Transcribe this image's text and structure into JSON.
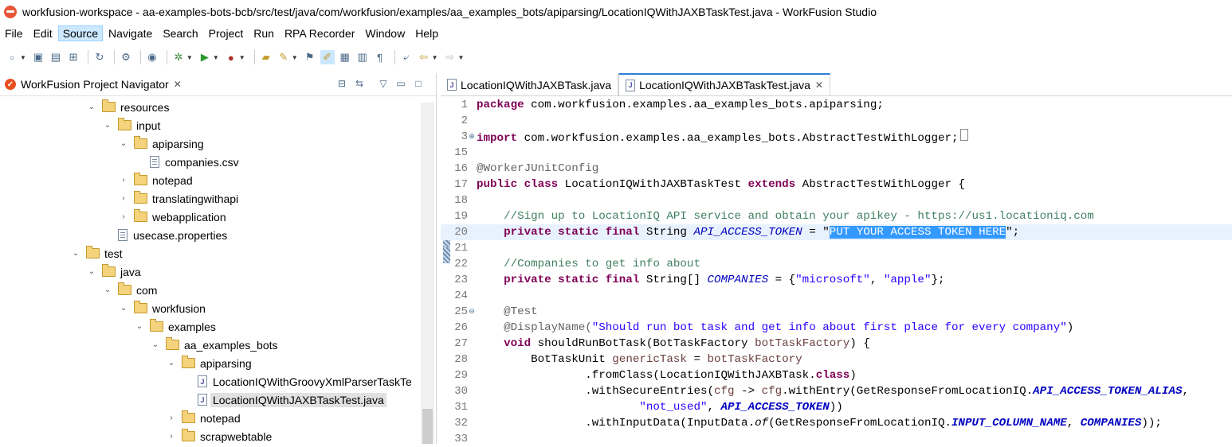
{
  "window": {
    "title": "workfusion-workspace - aa-examples-bots-bcb/src/test/java/com/workfusion/examples/aa_examples_bots/apiparsing/LocationIQWithJAXBTaskTest.java - WorkFusion Studio"
  },
  "menu": [
    "File",
    "Edit",
    "Source",
    "Navigate",
    "Search",
    "Project",
    "Run",
    "RPA Recorder",
    "Window",
    "Help"
  ],
  "menu_active": "Source",
  "navigator": {
    "title": "WorkFusion Project Navigator",
    "items": [
      {
        "label": "resources",
        "type": "folder",
        "expanded": true
      },
      {
        "label": "input",
        "type": "folder",
        "expanded": true
      },
      {
        "label": "apiparsing",
        "type": "folder",
        "expanded": true
      },
      {
        "label": "companies.csv",
        "type": "file"
      },
      {
        "label": "notepad",
        "type": "folder",
        "expanded": false
      },
      {
        "label": "translatingwithapi",
        "type": "folder",
        "expanded": false
      },
      {
        "label": "webapplication",
        "type": "folder",
        "expanded": false
      },
      {
        "label": "usecase.properties",
        "type": "file"
      },
      {
        "label": "test",
        "type": "folder",
        "expanded": true
      },
      {
        "label": "java",
        "type": "folder",
        "expanded": true
      },
      {
        "label": "com",
        "type": "folder",
        "expanded": true
      },
      {
        "label": "workfusion",
        "type": "folder",
        "expanded": true
      },
      {
        "label": "examples",
        "type": "folder",
        "expanded": true
      },
      {
        "label": "aa_examples_bots",
        "type": "folder",
        "expanded": true
      },
      {
        "label": "apiparsing",
        "type": "folder",
        "expanded": true
      },
      {
        "label": "LocationIQWithGroovyXmlParserTaskTe",
        "type": "java"
      },
      {
        "label": "LocationIQWithJAXBTaskTest.java",
        "type": "java",
        "selected": true
      },
      {
        "label": "notepad",
        "type": "folder",
        "expanded": false
      },
      {
        "label": "scrapwebtable",
        "type": "folder",
        "expanded": false
      }
    ]
  },
  "editor": {
    "tabs": [
      {
        "label": "LocationIQWithJAXBTask.java",
        "active": false
      },
      {
        "label": "LocationIQWithJAXBTaskTest.java",
        "active": true
      }
    ],
    "line_numbers": [
      "1",
      "2",
      "3",
      "15",
      "16",
      "17",
      "18",
      "19",
      "20",
      "21",
      "22",
      "23",
      "24",
      "25",
      "26",
      "27",
      "28",
      "29",
      "30",
      "31",
      "32",
      "33"
    ],
    "code": {
      "l1_kw": "package",
      "l1_rest": " com.workfusion.examples.aa_examples_bots.apiparsing;",
      "l3_kw": "import",
      "l3_rest": " com.workfusion.examples.aa_examples_bots.AbstractTestWithLogger;",
      "l16_an": "@WorkerJUnitConfig",
      "l17_kw1": "public class",
      "l17_mid": " LocationIQWithJAXBTaskTest ",
      "l17_kw2": "extends",
      "l17_rest": " AbstractTestWithLogger {",
      "l19_cm": "//Sign up to LocationIQ API service and obtain your apikey - https://us1.locationiq.com",
      "l20_kw": "private static final",
      "l20_type": " String ",
      "l20_fd": "API_ACCESS_TOKEN",
      "l20_eq": " = \"",
      "l20_sel": "PUT YOUR ACCESS TOKEN HERE",
      "l20_end": "\";",
      "l22_cm": "//Companies to get info about",
      "l23_kw": "private static final",
      "l23_type": " String[] ",
      "l23_fd": "COMPANIES",
      "l23_eq": " = {",
      "l23_s1": "\"microsoft\"",
      "l23_comma": ", ",
      "l23_s2": "\"apple\"",
      "l23_end": "};",
      "l25_an": "@Test",
      "l26_an": "@DisplayName(",
      "l26_st": "\"Should run bot task and get info about first place for every company\"",
      "l26_end": ")",
      "l27_kw": "void",
      "l27_rest": " shouldRunBotTask(BotTaskFactory ",
      "l27_lv": "botTaskFactory",
      "l27_end": ") {",
      "l28_a": "BotTaskUnit ",
      "l28_lv": "genericTask",
      "l28_b": " = ",
      "l28_lv2": "botTaskFactory",
      "l29_a": ".fromClass(LocationIQWithJAXBTask.",
      "l29_kw": "class",
      "l29_b": ")",
      "l30_a": ".withSecureEntries(",
      "l30_lv": "cfg",
      "l30_b": " -> ",
      "l30_lv2": "cfg",
      "l30_c": ".withEntry(GetResponseFromLocationIQ.",
      "l30_fd": "API_ACCESS_TOKEN_ALIAS",
      "l30_d": ",",
      "l31_st": "\"not_used\"",
      "l31_a": ", ",
      "l31_fd": "API_ACCESS_TOKEN",
      "l31_b": "))",
      "l32_a": ".withInputData(InputData.",
      "l32_it": "of",
      "l32_b": "(GetResponseFromLocationIQ.",
      "l32_fd": "INPUT_COLUMN_NAME",
      "l32_c": ", ",
      "l32_fd2": "COMPANIES",
      "l32_d": "));"
    }
  }
}
